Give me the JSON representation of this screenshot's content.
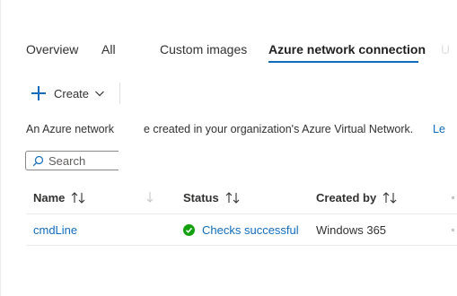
{
  "tabs": [
    {
      "label": "Overview"
    },
    {
      "label": "All C"
    },
    {
      "label": "Custom images"
    },
    {
      "label": "Azure network connection"
    },
    {
      "label": "U"
    }
  ],
  "toolbar": {
    "create_label": "Create"
  },
  "description": {
    "text_left": "An Azure network",
    "text_right": "e created in your organization's Azure Virtual Network.",
    "link": "Le"
  },
  "search": {
    "placeholder": "Search"
  },
  "table": {
    "columns": [
      {
        "label": "Name"
      },
      {
        "label": "Status"
      },
      {
        "label": "Created by"
      }
    ],
    "rows": [
      {
        "name": "cmdLine",
        "status": "Checks successful",
        "created_by": "Windows 365"
      }
    ]
  },
  "colors": {
    "accent": "#0f6cbd",
    "success": "#13a10e"
  }
}
